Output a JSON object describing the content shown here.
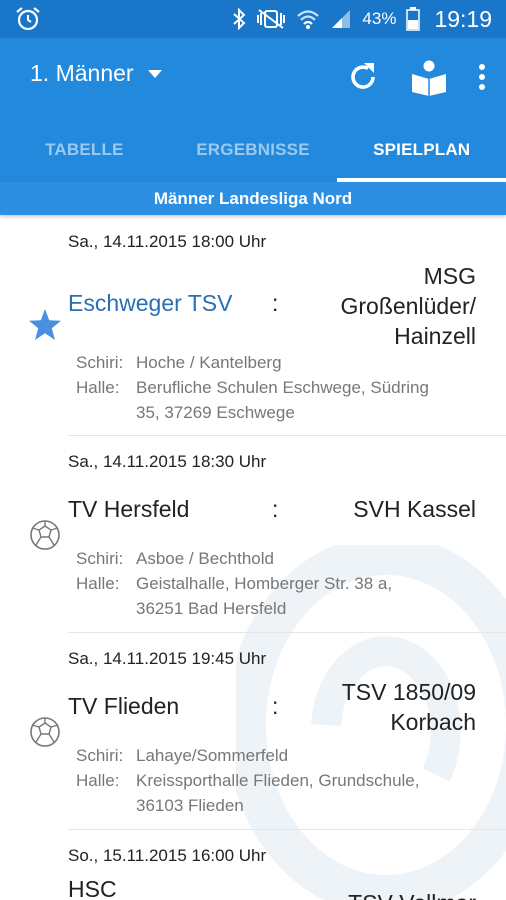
{
  "status_bar": {
    "battery": "43%",
    "time": "19:19",
    "icons": [
      "alarm-icon",
      "bluetooth-icon",
      "vibrate-mute-icon",
      "wifi-icon",
      "signal-icon",
      "battery-icon"
    ]
  },
  "app_bar": {
    "title": "1. Männer",
    "actions": [
      "refresh-icon",
      "book-reader-icon",
      "overflow-menu-icon"
    ]
  },
  "tabs": [
    {
      "label": "TABELLE",
      "active": false
    },
    {
      "label": "ERGEBNISSE",
      "active": false
    },
    {
      "label": "SPIELPLAN",
      "active": true
    }
  ],
  "league": "Männer Landesliga Nord",
  "labels": {
    "referee": "Schiri:",
    "hall": "Halle:",
    "separator": ":"
  },
  "matches": [
    {
      "date": "Sa., 14.11.2015 18:00 Uhr",
      "home": "Eschweger TSV",
      "away_lines": [
        "MSG",
        "Großenlüder/",
        "Hainzell"
      ],
      "referee": "Hoche / Kantelberg",
      "hall_lines": [
        "Berufliche Schulen Eschwege, Südring",
        "35, 37269  Eschwege"
      ],
      "marker": "star-icon"
    },
    {
      "date": "Sa., 14.11.2015 18:30 Uhr",
      "home": "TV Hersfeld",
      "away_lines": [
        "SVH Kassel"
      ],
      "referee": "Asboe / Bechthold",
      "hall_lines": [
        "Geistalhalle, Homberger Str. 38 a,",
        "36251  Bad Hersfeld"
      ],
      "marker": "handball-icon"
    },
    {
      "date": "Sa., 14.11.2015 19:45 Uhr",
      "home": "TV Flieden",
      "away_lines": [
        "TSV 1850/09",
        "Korbach"
      ],
      "referee": "Lahaye/Sommerfeld",
      "hall_lines": [
        "Kreissporthalle Flieden, Grundschule,",
        "36103  Flieden"
      ],
      "marker": "handball-icon"
    },
    {
      "date": "So., 15.11.2015 16:00 Uhr",
      "home": "HSC",
      "away_lines": [
        "TSV Vellmar"
      ]
    }
  ],
  "colors": {
    "status_bar": "#1976c9",
    "app_bar": "#2389dd",
    "favorite_team": "#2a6fb5",
    "star": "#4a90e2"
  }
}
